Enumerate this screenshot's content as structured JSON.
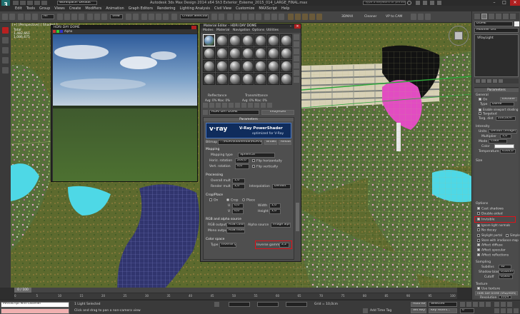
{
  "title_bar": {
    "workspace": "Workspace: Default",
    "window_title": "Autodesk 3ds Max Design 2014 x64     Sh3 Exterior_Eskeme_2015_014_LARGE_FINAL.max",
    "search_placeholder": "Type a keyword or phrase"
  },
  "menu": [
    "Edit",
    "Tools",
    "Group",
    "Views",
    "Create",
    "Modifiers",
    "Animation",
    "Graph Editors",
    "Rendering",
    "Lighting Analysis",
    "Civil View",
    "Customize",
    "MAXScript",
    "Help"
  ],
  "toolbar": {
    "selection_filter": "All",
    "view_dropdown": "View",
    "create_selection_set": "Create Selection Se",
    "recent": "3DMAX",
    "cleaner": "Cleaner",
    "vp_to_cam": "VP to CAM"
  },
  "viewport": {
    "label": "[+] [Perspective] [ Shaded ]",
    "stats": [
      "Total",
      "1,482,661",
      "1,086,675"
    ]
  },
  "vfb": {
    "title": "HDRI DAY DOME",
    "channel": "Alpha"
  },
  "material_editor": {
    "title": "Material Editor - HDRI DAY DOME",
    "menus": [
      "Modes",
      "Material",
      "Navigation",
      "Options",
      "Utilities"
    ],
    "reflectance_label": "Reflectance",
    "transmittance_label": "Transmittance",
    "reflect_vals": "Avg:  0%  Max:  0%",
    "trans_vals": "Avg:  0%  Max:  0%",
    "material_name": "HDRI DAY DOME",
    "type_button": "VRayHDRI",
    "params_header": "Parameters",
    "banner_brand": "v·ray",
    "banner_title": "V-Ray PowerShader",
    "banner_sub": "optimized for V-Ray",
    "bitmap_label": "Bitmap",
    "bitmap_path": "...\\HDRI\\Kloofendal\\HDRI\\BSKS...",
    "browse_label": "Browse",
    "reload_label": "Reload",
    "mapping_section": "Mapping",
    "mapping_type_label": "Mapping type",
    "mapping_type_value": "Spherical",
    "horiz_rotation_label": "Horiz. rotation",
    "horiz_rotation_value": "200,0",
    "vert_rotation_label": "Vert. rotation",
    "vert_rotation_value": "0,0",
    "flip_horiz": "Flip horizontally",
    "flip_vert": "Flip vertically",
    "processing_section": "Processing",
    "overall_mult_label": "Overall mult",
    "overall_mult_value": "1,0",
    "render_mult_label": "Render mult",
    "render_mult_value": "1,0",
    "interp_label": "Interpolation",
    "interp_value": "Default",
    "crop_section": "Crop/Place",
    "on_label": "On",
    "crop_label": "Crop",
    "place_label": "Place",
    "u_label": "U",
    "u_value": "0,0",
    "v_label": "V",
    "v_value": "0,0",
    "w_label": "Width",
    "w_value": "1,0",
    "h_label": "Height",
    "h_value": "1,0",
    "rgb_alpha_section": "RGB and alpha source",
    "rgb_output_label": "RGB output",
    "rgb_output_value": "RGB color",
    "alpha_source_label": "Alpha source",
    "alpha_source_value": "Image alph",
    "mono_output_label": "Mono output",
    "mono_output_value": "RGB intens",
    "color_space_section": "Color space",
    "type_label": "Type",
    "type_value": "Inverse ga",
    "inverse_gamma_label": "Inverse gamma",
    "inverse_gamma_value": "2,2"
  },
  "command_panel": {
    "object_name": "DOME",
    "modifier_list": "Modifier List",
    "stack_item": "VRayLight",
    "params_header": "Parameters",
    "general": "General",
    "on": "On",
    "exclude": "Exclude",
    "type_label": "Type",
    "type_value": "Dome",
    "enable_vp_shading": "Enable viewport shading",
    "targeted": "Targeted",
    "targ_dist_label": "Targ. dist",
    "targ_dist_value": "200,0cm",
    "intensity": "Intensity",
    "units_label": "Units",
    "units_value": "Default (image)",
    "multiplier_label": "Multiplier",
    "multiplier_value": "1,0",
    "mode_label": "Mode",
    "mode_value": "Color",
    "color_label": "Color",
    "temperature_label": "Temperature",
    "temperature_value": "6500,0",
    "size": "Size",
    "options": "Options",
    "cast_shadows": "Cast shadows",
    "double_sided": "Double-sided",
    "invisible": "Invisible",
    "ignore_normals": "Ignore light normals",
    "no_decay": "No decay",
    "skylight_portal": "Skylight portal",
    "simple": "Simple",
    "store_irradiance": "Store with irradiance map",
    "affect_diffuse": "Affect diffuse",
    "affect_specular": "Affect specular",
    "affect_reflections": "Affect reflections",
    "sampling": "Sampling",
    "subdivs_label": "Subdivs",
    "subdivs_value": "32",
    "shadow_bias_label": "Shadow bias",
    "shadow_bias_value": "0,02cm",
    "cutoff_label": "Cutoff",
    "cutoff_value": "0,001",
    "texture": "Texture",
    "use_texture": "Use texture",
    "tex_map": "HDRI DAY DOME (VRayHDRI)",
    "resolution_label": "Resolution",
    "resolution_value": "1024"
  },
  "timeline": {
    "frame": "0 / 100",
    "ticks": [
      "0",
      "5",
      "10",
      "15",
      "20",
      "25",
      "30",
      "35",
      "40",
      "45",
      "50",
      "55",
      "60",
      "65",
      "70",
      "75",
      "80",
      "85",
      "90",
      "95",
      "100"
    ]
  },
  "status": {
    "maxscript": "MAXScript Mini Listener",
    "selection": "1 Light Selected",
    "prompt": "Click and drag to pan a non-camera view",
    "grid": "Grid = 10,0cm",
    "auto_key": "Auto Key",
    "selected": "Selected",
    "set_key": "Set Key",
    "key_filters": "Key Filters...",
    "add_time_tag": "Add Time Tag",
    "frame_value": "0"
  },
  "colors": {
    "highlight_red": "#e0121a",
    "accent_teal": "#1f6f6f"
  }
}
